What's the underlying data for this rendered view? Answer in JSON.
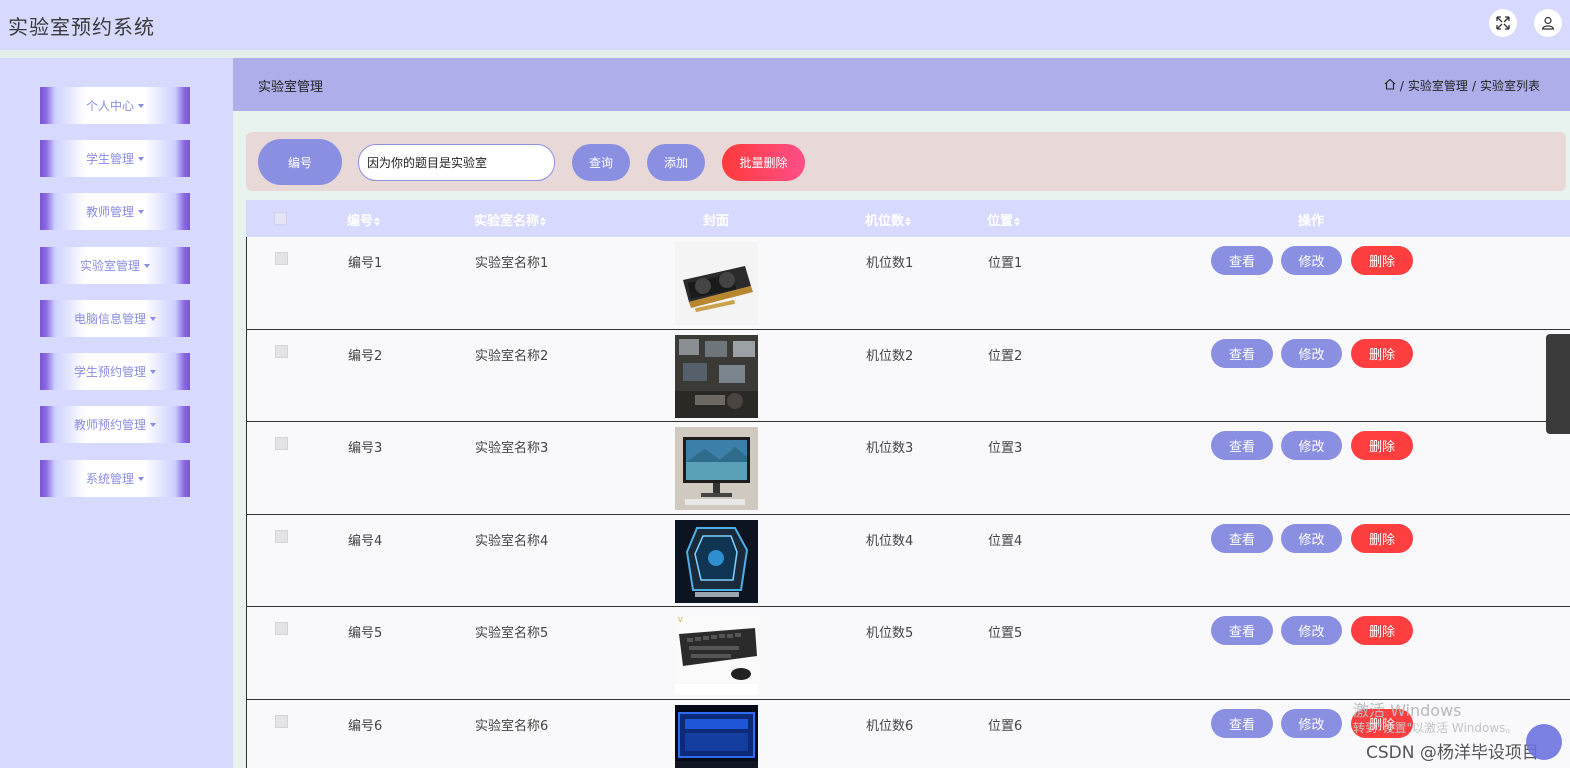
{
  "app": {
    "title": "实验室预约系统"
  },
  "header": {
    "expand_icon": "fullscreen-icon",
    "user_icon": "user-icon"
  },
  "sidebar": {
    "items": [
      {
        "label": "个人中心"
      },
      {
        "label": "学生管理"
      },
      {
        "label": "教师管理"
      },
      {
        "label": "实验室管理"
      },
      {
        "label": "电脑信息管理"
      },
      {
        "label": "学生预约管理"
      },
      {
        "label": "教师预约管理"
      },
      {
        "label": "系统管理"
      }
    ]
  },
  "breadcrumb": {
    "page_title": "实验室管理",
    "home_icon": "home-icon",
    "items": [
      "实验室管理",
      "实验室列表"
    ],
    "separator": "/"
  },
  "search": {
    "field_label": "编号",
    "input_value": "因为你的题目是实验室",
    "query_label": "查询",
    "add_label": "添加",
    "bulk_delete_label": "批量删除"
  },
  "table": {
    "columns": [
      "编号",
      "实验室名称",
      "封面",
      "机位数",
      "位置",
      "操作"
    ],
    "rows": [
      {
        "id": "编号1",
        "name": "实验室名称1",
        "seats": "机位数1",
        "location": "位置1"
      },
      {
        "id": "编号2",
        "name": "实验室名称2",
        "seats": "机位数2",
        "location": "位置2"
      },
      {
        "id": "编号3",
        "name": "实验室名称3",
        "seats": "机位数3",
        "location": "位置3"
      },
      {
        "id": "编号4",
        "name": "实验室名称4",
        "seats": "机位数4",
        "location": "位置4"
      },
      {
        "id": "编号5",
        "name": "实验室名称5",
        "seats": "机位数5",
        "location": "位置5"
      },
      {
        "id": "编号6",
        "name": "实验室名称6",
        "seats": "机位数6",
        "location": "位置6"
      }
    ],
    "actions": {
      "view": "查看",
      "edit": "修改",
      "delete": "删除"
    }
  },
  "watermark": {
    "line1": "激活 Windows",
    "line2": "转到\"设置\"以激活 Windows。",
    "csdn": "CSDN @杨洋毕设项目"
  },
  "colors": {
    "accent": "#8b8fe2",
    "danger": "#ff3f3f",
    "header_bg": "#d7d9fe",
    "crumb_bg": "#adaeea"
  }
}
